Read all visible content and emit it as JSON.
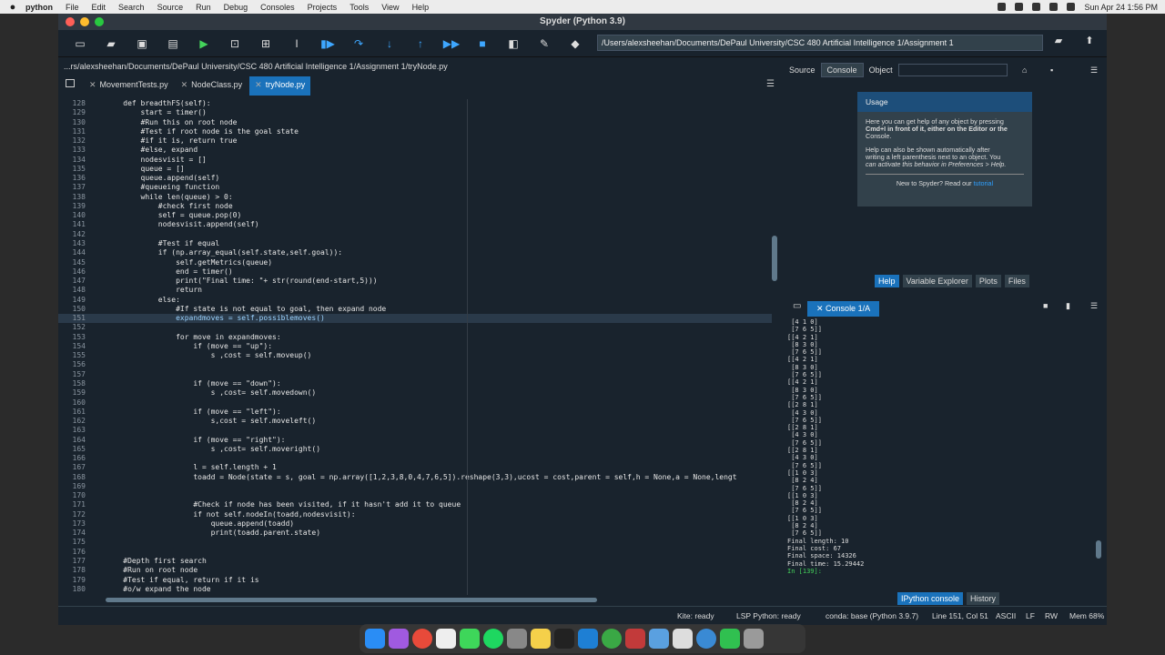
{
  "menubar": {
    "app": "python",
    "items": [
      "File",
      "Edit",
      "Search",
      "Source",
      "Run",
      "Debug",
      "Consoles",
      "Projects",
      "Tools",
      "View",
      "Help"
    ],
    "clock": "Sun Apr 24  1:56 PM"
  },
  "window": {
    "title": "Spyder (Python 3.9)"
  },
  "toolbar": {
    "working_dir": "/Users/alexsheehan/Documents/DePaul University/CSC 480 Artificial Intelligence 1/Assignment 1"
  },
  "editor": {
    "file_path": "...rs/alexsheehan/Documents/DePaul University/CSC 480 Artificial Intelligence 1/Assignment 1/tryNode.py",
    "tabs": [
      "MovementTests.py",
      "NodeClass.py",
      "tryNode.py"
    ],
    "active_tab": "tryNode.py",
    "current_line": 151,
    "lines": [
      {
        "no": "128",
        "text": "    def breadthFS(self):"
      },
      {
        "no": "129",
        "text": "        start = timer()"
      },
      {
        "no": "130",
        "text": "        #Run this on root node"
      },
      {
        "no": "131",
        "text": "        #Test if root node is the goal state"
      },
      {
        "no": "132",
        "text": "        #if it is, return true"
      },
      {
        "no": "133",
        "text": "        #else, expand"
      },
      {
        "no": "134",
        "text": "        nodesvisit = []"
      },
      {
        "no": "135",
        "text": "        queue = []"
      },
      {
        "no": "136",
        "text": "        queue.append(self)"
      },
      {
        "no": "137",
        "text": "        #queueing function"
      },
      {
        "no": "138",
        "text": "        while len(queue) > 0:"
      },
      {
        "no": "139",
        "text": "            #check first node"
      },
      {
        "no": "140",
        "text": "            self = queue.pop(0)"
      },
      {
        "no": "141",
        "text": "            nodesvisit.append(self)"
      },
      {
        "no": "142",
        "text": ""
      },
      {
        "no": "143",
        "text": "            #Test if equal"
      },
      {
        "no": "144",
        "text": "            if (np.array_equal(self.state,self.goal)):"
      },
      {
        "no": "145",
        "text": "                self.getMetrics(queue)"
      },
      {
        "no": "146",
        "text": "                end = timer()"
      },
      {
        "no": "147",
        "text": "                print(\"Final time: \"+ str(round(end-start,5)))"
      },
      {
        "no": "148",
        "text": "                return"
      },
      {
        "no": "149",
        "text": "            else:"
      },
      {
        "no": "150",
        "text": "                #If state is not equal to goal, then expand node"
      },
      {
        "no": "151",
        "text": "                expandmoves = self.possiblemoves()"
      },
      {
        "no": "152",
        "text": ""
      },
      {
        "no": "153",
        "text": "                for move in expandmoves:"
      },
      {
        "no": "154",
        "text": "                    if (move == \"up\"):"
      },
      {
        "no": "155",
        "text": "                        s ,cost = self.moveup()"
      },
      {
        "no": "156",
        "text": ""
      },
      {
        "no": "157",
        "text": ""
      },
      {
        "no": "158",
        "text": "                    if (move == \"down\"):"
      },
      {
        "no": "159",
        "text": "                        s ,cost= self.movedown()"
      },
      {
        "no": "160",
        "text": ""
      },
      {
        "no": "161",
        "text": "                    if (move == \"left\"):"
      },
      {
        "no": "162",
        "text": "                        s,cost = self.moveleft()"
      },
      {
        "no": "163",
        "text": ""
      },
      {
        "no": "164",
        "text": "                    if (move == \"right\"):"
      },
      {
        "no": "165",
        "text": "                        s ,cost= self.moveright()"
      },
      {
        "no": "166",
        "text": ""
      },
      {
        "no": "167",
        "text": "                    l = self.length + 1"
      },
      {
        "no": "168",
        "text": "                    toadd = Node(state = s, goal = np.array([1,2,3,8,0,4,7,6,5]).reshape(3,3),ucost = cost,parent = self,h = None,a = None,lengt"
      },
      {
        "no": "169",
        "text": ""
      },
      {
        "no": "170",
        "text": ""
      },
      {
        "no": "171",
        "text": "                    #Check if node has been visited, if it hasn't add it to queue"
      },
      {
        "no": "172",
        "text": "                    if not self.nodeIn(toadd,nodesvisit):"
      },
      {
        "no": "173",
        "text": "                        queue.append(toadd)"
      },
      {
        "no": "174",
        "text": "                        print(toadd.parent.state)"
      },
      {
        "no": "175",
        "text": ""
      },
      {
        "no": "176",
        "text": ""
      },
      {
        "no": "177",
        "text": "    #Depth first search"
      },
      {
        "no": "178",
        "text": "    #Run on root node"
      },
      {
        "no": "179",
        "text": "    #Test if equal, return if it is"
      },
      {
        "no": "180",
        "text": "    #o/w expand the node"
      }
    ]
  },
  "help": {
    "source_label": "Source",
    "source_value": "Console",
    "object_label": "Object",
    "usage_title": "Usage",
    "usage_p1a": "Here you can get help of any object by pressing",
    "usage_p1b": "Cmd+I in front of it, either on the Editor or the",
    "usage_p1c": "Console.",
    "usage_p2a": "Help can also be shown automatically after",
    "usage_p2b": "writing a left parenthesis next to an object. You",
    "usage_p2c": "can activate this behavior in Preferences > Help.",
    "usage_foot": "New to Spyder? Read our",
    "usage_link": "tutorial",
    "tabs": [
      "Help",
      "Variable Explorer",
      "Plots",
      "Files"
    ]
  },
  "console": {
    "tab": "Console 1/A",
    "output": [
      " [4 1 0]",
      " [7 6 5]]",
      "[[4 2 1]",
      " [8 3 0]",
      " [7 6 5]]",
      "[[4 2 1]",
      " [8 3 0]",
      " [7 6 5]]",
      "[[4 2 1]",
      " [8 3 0]",
      " [7 6 5]]",
      "[[2 8 1]",
      " [4 3 0]",
      " [7 6 5]]",
      "[[2 8 1]",
      " [4 3 0]",
      " [7 6 5]]",
      "[[2 8 1]",
      " [4 3 0]",
      " [7 6 5]]",
      "[[1 0 3]",
      " [8 2 4]",
      " [7 6 5]]",
      "[[1 0 3]",
      " [8 2 4]",
      " [7 6 5]]",
      "[[1 0 3]",
      " [8 2 4]",
      " [7 6 5]]",
      "Final length: 10",
      "Final cost: 67",
      "Final space: 14326",
      "Final time: 15.29442"
    ],
    "prompt": "In [139]:",
    "tabs": [
      "IPython console",
      "History"
    ]
  },
  "statusbar": {
    "kite": "Kite: ready",
    "lsp": "LSP Python: ready",
    "conda": "conda: base (Python 3.9.7)",
    "position": "Line 151, Col 51",
    "encoding": "ASCII",
    "eol": "LF",
    "rw": "RW",
    "mem": "Mem 68%"
  }
}
